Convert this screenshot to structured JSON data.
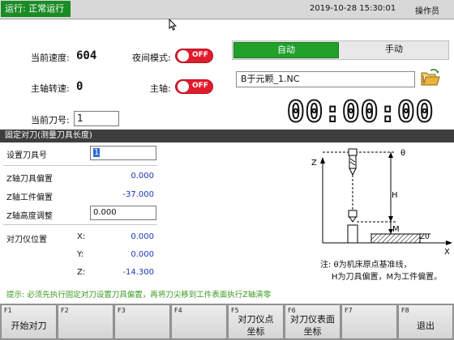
{
  "topbar": {
    "status": "运行: 正常运行",
    "datetime": "2019-10-28 15:30:01",
    "operator": "操作员"
  },
  "upper": {
    "speed_label": "当前速度:",
    "speed_value": "604",
    "spindle_label": "主轴转速:",
    "spindle_value": "0",
    "tool_label": "当前刀号:",
    "tool_value": "1",
    "night_label": "夜间模式:",
    "night_state": "OFF",
    "spindle_switch_label": "主轴:",
    "spindle_switch_state": "OFF"
  },
  "mode": {
    "auto": "自动",
    "manual": "手动",
    "program": "B于元颗_1.NC",
    "timer": "00:00:00"
  },
  "section": {
    "title": "固定对刀(测量刀具长度)"
  },
  "form": {
    "set_tool_label": "设置刀具号",
    "set_tool_value": "1",
    "z_tool_offset_label": "Z轴刀具偏置",
    "z_tool_offset_value": "0.000",
    "z_work_offset_label": "Z轴工件偏置",
    "z_work_offset_value": "-37.000",
    "z_height_adjust_label": "Z轴高度调整",
    "z_height_adjust_value": "0.000",
    "setter_pos_label": "对刀仪位置",
    "x_label": "X:",
    "x_value": "0.000",
    "y_label": "Y:",
    "y_value": "0.000",
    "z_label": "Z:",
    "z_value": "-14.300"
  },
  "diagram": {
    "theta": "θ",
    "z_axis": "Z",
    "x_axis": "X",
    "h": "H",
    "m": "M",
    "z0": "Z0",
    "note_line1": "注: θ为机床原点基准线，",
    "note_line2": "H为刀具偏置，M为工件偏置。"
  },
  "hint": "提示: 必须先执行固定对刀设置刀具偏置，再将刀尖移到工件表面执行Z轴清零",
  "fkeys": [
    {
      "num": "F1",
      "line1": "开始对刀",
      "line2": ""
    },
    {
      "num": "F2",
      "line1": "",
      "line2": ""
    },
    {
      "num": "F3",
      "line1": "",
      "line2": ""
    },
    {
      "num": "F4",
      "line1": "",
      "line2": ""
    },
    {
      "num": "F5",
      "line1": "对刀仪点",
      "line2": "坐标"
    },
    {
      "num": "F6",
      "line1": "对刀仪表面",
      "line2": "坐标"
    },
    {
      "num": "F7",
      "line1": "",
      "line2": ""
    },
    {
      "num": "F8",
      "line1": "退出",
      "line2": ""
    }
  ],
  "colors": {
    "status_green": "#1a8b25",
    "tab_active": "#21a02c",
    "toggle_off": "#e11c2d",
    "value_blue": "#1b36b6",
    "hint_green": "#3c9a1f"
  }
}
